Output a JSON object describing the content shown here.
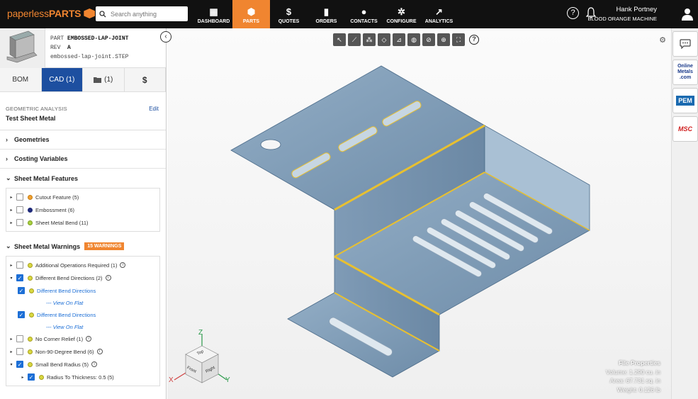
{
  "logo": {
    "part1": "paperless",
    "part2": "PARTS"
  },
  "search": {
    "placeholder": "Search anything"
  },
  "nav": [
    {
      "label": "DASHBOARD",
      "icon": "grid-icon"
    },
    {
      "label": "PARTS",
      "icon": "cube-icon"
    },
    {
      "label": "QUOTES",
      "icon": "dollar-icon"
    },
    {
      "label": "ORDERS",
      "icon": "clipboard-icon"
    },
    {
      "label": "CONTACTS",
      "icon": "users-icon"
    },
    {
      "label": "CONFIGURE",
      "icon": "gears-icon"
    },
    {
      "label": "ANALYTICS",
      "icon": "chart-icon"
    }
  ],
  "user": {
    "name": "Hank Portney",
    "org": "BLOOD ORANGE MACHINE"
  },
  "part": {
    "label_part": "PART",
    "name": "EMBOSSED-LAP-JOINT",
    "label_rev": "REV",
    "rev": "A",
    "file": "embossed-lap-joint.STEP"
  },
  "tabs": [
    {
      "label": "BOM"
    },
    {
      "label": "CAD (1)"
    },
    {
      "label": "(1)"
    },
    {
      "label": "$"
    }
  ],
  "geometric": {
    "label": "GEOMETRIC ANALYSIS",
    "value": "Test Sheet Metal",
    "edit": "Edit"
  },
  "sections": {
    "geometries": "Geometries",
    "costing": "Costing Variables",
    "features": "Sheet Metal Features",
    "warnings": "Sheet Metal Warnings",
    "warnings_badge": "15 WARNINGS"
  },
  "features": [
    {
      "label": "Cutout Feature (5)"
    },
    {
      "label": "Embossment (6)"
    },
    {
      "label": "Sheet Metal Bend (11)"
    }
  ],
  "warnings": [
    {
      "label": "Additional Operations Required (1)"
    },
    {
      "label": "Different Bend Directions (2)"
    },
    {
      "label": "Different Bend Directions"
    },
    {
      "label": "--- View On Flat"
    },
    {
      "label": "Different Bend Directions"
    },
    {
      "label": "--- View On Flat"
    },
    {
      "label": "No Corner Relief (1)"
    },
    {
      "label": "Non-90-Degree Bend (6)"
    },
    {
      "label": "Small Bend Radius (5)"
    },
    {
      "label": "Radius To Thickness: 0.5 (5)"
    }
  ],
  "viewcube": {
    "x": "X",
    "y": "Y",
    "z": "Z",
    "top": "Top",
    "front": "Front",
    "right": "Right"
  },
  "file_props": {
    "title": "File Properties",
    "volume": "Volume: 1.290 cu. in",
    "area": "Area: 67.731 sq. in",
    "weight": "Weight: 0.126 lb"
  },
  "rail": [
    {
      "label": "",
      "icon": "chat-icon"
    },
    {
      "label": "Online Metals .com"
    },
    {
      "label": "PEM"
    },
    {
      "label": "MSC"
    }
  ]
}
